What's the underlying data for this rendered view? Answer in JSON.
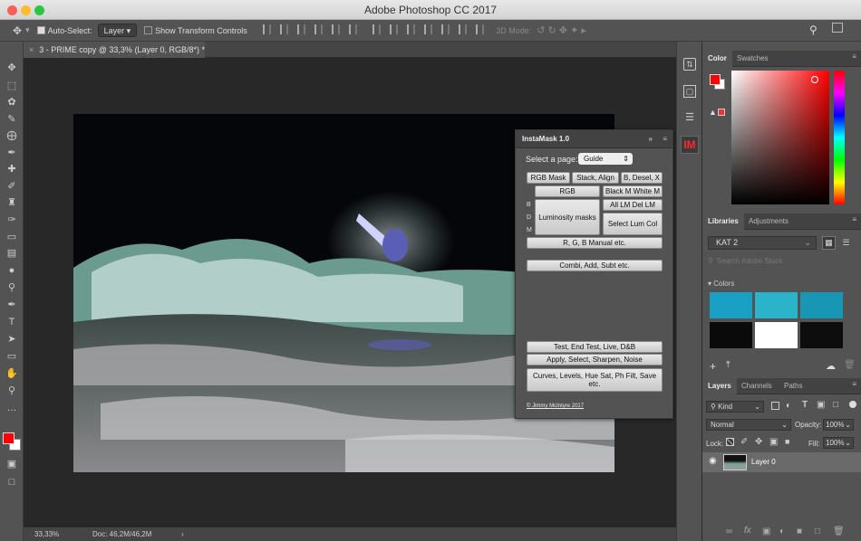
{
  "window": {
    "title": "Adobe Photoshop CC 2017"
  },
  "options": {
    "auto_select_label": "Auto-Select:",
    "auto_select_value": "Layer",
    "show_transform_label": "Show Transform Controls",
    "mode3d_label": "3D Mode:"
  },
  "document": {
    "tab_title": "3 - PRIME copy @ 33,3% (Layer 0, RGB/8*) *"
  },
  "status": {
    "zoom": "33,33%",
    "doc": "Doc: 46,2M/46,2M",
    "arrow": "›"
  },
  "instamask": {
    "title": "InstaMask 1.0",
    "select_label": "Select a page:",
    "select_value": "Guide",
    "buttons": {
      "rgb_mask": "RGB Mask",
      "stack_align": "Stack, Align",
      "b_desel": "B, Desel, X",
      "rgb": "RGB",
      "black_white": "Black M White M",
      "all_lm": "All LM Del LM",
      "luminosity": "Luminosity masks",
      "select_lum": "Select Lum Col",
      "rgb_manual": "R, G, B Manual etc.",
      "combi": "Combi, Add, Subt etc.",
      "test": "Test, End Test, Live, D&B",
      "apply": "Apply, Select, Sharpen, Noise",
      "curves": "Curves, Levels, Hue Sat, Ph Filt, Save etc."
    },
    "side_b": "B",
    "side_d": "D",
    "side_m": "M",
    "copyright": "© Jimmy McIntyre 2017"
  },
  "color_panel": {
    "tab_color": "Color",
    "tab_swatches": "Swatches",
    "fg": "#ff0000",
    "bg": "#ffffff"
  },
  "libraries": {
    "tab_libraries": "Libraries",
    "tab_adjustments": "Adjustments",
    "library_name": "KAT 2",
    "search_placeholder": "Search Adobe Stock",
    "colors_heading": "Colors",
    "swatch_colors": [
      "#1aa0c4",
      "#2ab3c9",
      "#1897b5",
      "#0a0a0a",
      "#ffffff",
      "#0d0d0d"
    ]
  },
  "layers": {
    "tab_layers": "Layers",
    "tab_channels": "Channels",
    "tab_paths": "Paths",
    "kind": "Kind",
    "blend_mode": "Normal",
    "opacity_label": "Opacity:",
    "opacity": "100%",
    "lock_label": "Lock:",
    "fill_label": "Fill:",
    "fill": "100%",
    "layer_name": "Layer 0"
  }
}
